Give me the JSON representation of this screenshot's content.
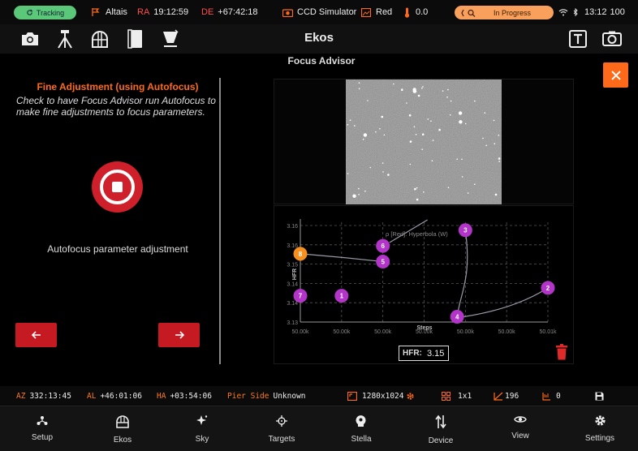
{
  "status_bar": {
    "tracking_label": "Tracking",
    "mount_name": "Altais",
    "ra_label": "RA",
    "ra_value": "19:12:59",
    "de_label": "DE",
    "de_value": "+67:42:18",
    "camera_name": "CCD Simulator",
    "filter_name": "Red",
    "temperature": "0.0",
    "progress_label": "In Progress",
    "clock": "13:12",
    "battery": "100",
    "colors": {
      "tracking": "#5bc779",
      "progress": "#f9a15c",
      "accent": "#ff6a1a",
      "danger": "#cf1f2a"
    }
  },
  "toolbar": {
    "title": "Ekos",
    "left_icons": [
      "camera-icon",
      "tripod-icon",
      "observatory-dome-icon",
      "notebook-icon",
      "flat-panel-icon"
    ],
    "right_icons": [
      "text-overlay-icon",
      "capture-frame-icon"
    ]
  },
  "focus_advisor": {
    "title": "Focus Advisor",
    "close_icon": "close-icon",
    "step_title": "Fine Adjustment (using Autofocus)",
    "step_description": "Check to have Focus Advisor run Autofocus to make fine adjustments to focus parameters.",
    "stop_icon": "stop-icon",
    "status_label": "Autofocus parameter adjustment",
    "prev_icon": "arrow-left-icon",
    "next_icon": "arrow-right-icon",
    "hfr_label": "HFR:",
    "hfr_value": "3.15"
  },
  "chart_data": {
    "type": "scatter",
    "xlabel": "Steps",
    "ylabel": "HFR",
    "y_ticks": [
      "3.16",
      "3.16",
      "3.15",
      "3.14",
      "3.14",
      "3.13"
    ],
    "x_ticks": [
      "50.00k",
      "50.00k",
      "50.00k",
      "50.00k",
      "50.00k",
      "50.00k",
      "50.01k"
    ],
    "annotation": "ρ [Red]: Hyperbola (W)",
    "points": [
      {
        "label": "1",
        "x": 1,
        "y": 3.138,
        "highlight": false
      },
      {
        "label": "2",
        "x": 6,
        "y": 3.141,
        "highlight": false
      },
      {
        "label": "3",
        "x": 4,
        "y": 3.163,
        "highlight": false
      },
      {
        "label": "4",
        "x": 3.8,
        "y": 3.13,
        "highlight": false
      },
      {
        "label": "5",
        "x": 2,
        "y": 3.151,
        "highlight": false
      },
      {
        "label": "6",
        "x": 2,
        "y": 3.157,
        "highlight": false
      },
      {
        "label": "7",
        "x": 0,
        "y": 3.138,
        "highlight": false
      },
      {
        "label": "8",
        "x": 0,
        "y": 3.154,
        "highlight": true
      }
    ]
  },
  "info_bar": {
    "az_label": "AZ",
    "az_value": "332:13:45",
    "al_label": "AL",
    "al_value": "+46:01:06",
    "ha_label": "HA",
    "ha_value": "+03:54:06",
    "pier_label": "Pier Side",
    "pier_value": "Unknown",
    "frame_size": "1280x1024",
    "binning": "1x1",
    "gain": "196",
    "offset": "0"
  },
  "bottom_nav": [
    {
      "label": "Setup",
      "icon": "setup-icon"
    },
    {
      "label": "Ekos",
      "icon": "ekos-icon"
    },
    {
      "label": "Sky",
      "icon": "sky-icon"
    },
    {
      "label": "Targets",
      "icon": "targets-icon"
    },
    {
      "label": "Stella",
      "icon": "stella-icon"
    },
    {
      "label": "Device",
      "icon": "device-icon"
    },
    {
      "label": "View",
      "icon": "view-icon"
    },
    {
      "label": "Settings",
      "icon": "settings-icon"
    }
  ]
}
